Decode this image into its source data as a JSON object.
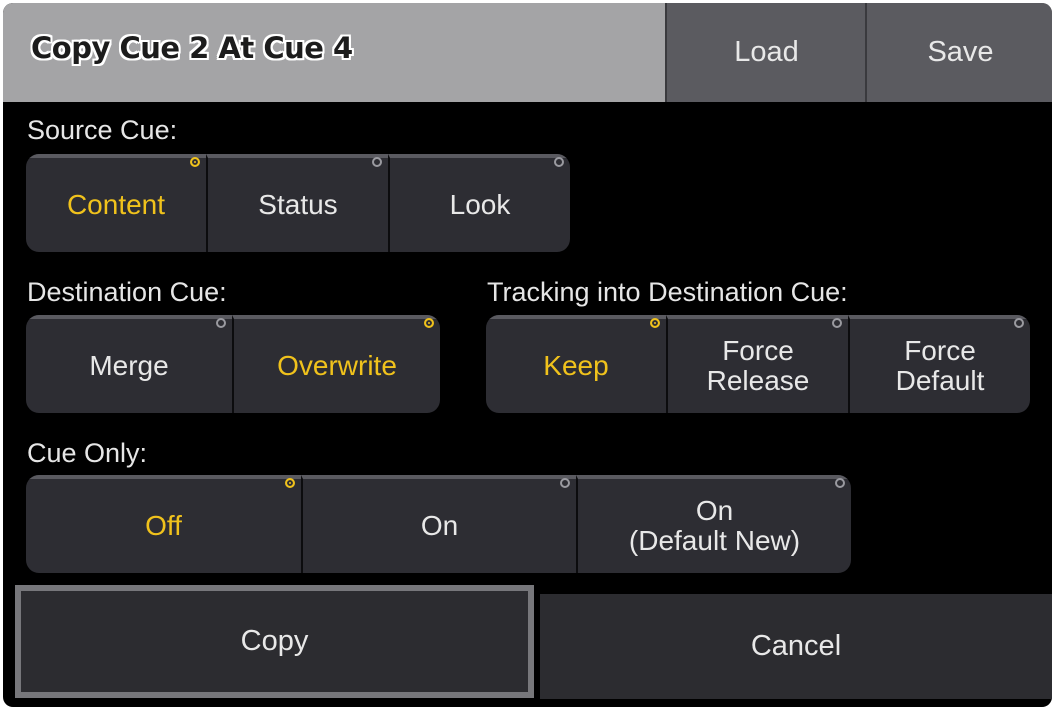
{
  "title": "Copy  Cue 2 At  Cue 4",
  "toolbar": {
    "load_label": "Load",
    "save_label": "Save"
  },
  "source": {
    "label": "Source Cue:",
    "options": [
      {
        "label": "Content",
        "selected": true
      },
      {
        "label": "Status",
        "selected": false
      },
      {
        "label": "Look",
        "selected": false
      }
    ]
  },
  "destination": {
    "label": "Destination Cue:",
    "options": [
      {
        "label": "Merge",
        "selected": false
      },
      {
        "label": "Overwrite",
        "selected": true
      }
    ]
  },
  "tracking": {
    "label": "Tracking into Destination Cue:",
    "options": [
      {
        "label": "Keep",
        "selected": true
      },
      {
        "label": "Force\nRelease",
        "selected": false
      },
      {
        "label": "Force\nDefault",
        "selected": false
      }
    ]
  },
  "cue_only": {
    "label": "Cue Only:",
    "options": [
      {
        "label": "Off",
        "selected": true
      },
      {
        "label": "On",
        "selected": false
      },
      {
        "label": "On\n(Default New)",
        "selected": false
      }
    ]
  },
  "actions": {
    "copy_label": "Copy",
    "cancel_label": "Cancel"
  },
  "colors": {
    "selected_text": "#f0c21c",
    "button_bg": "#2d2d33",
    "titlebar_bg": "#a4a4a6",
    "dialog_bg": "#000000"
  }
}
